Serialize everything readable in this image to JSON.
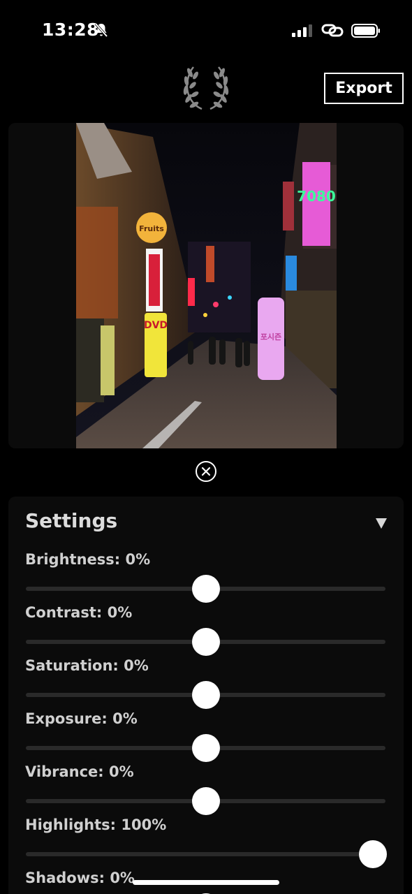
{
  "status_bar": {
    "time": "13:28"
  },
  "header": {
    "export_label": "Export"
  },
  "settings": {
    "title": "Settings",
    "sliders": [
      {
        "name": "Brightness",
        "label": "Brightness: 0%",
        "value": 0,
        "level": 0.5
      },
      {
        "name": "Contrast",
        "label": "Contrast: 0%",
        "value": 0,
        "level": 0.5
      },
      {
        "name": "Saturation",
        "label": "Saturation: 0%",
        "value": 0,
        "level": 0.5
      },
      {
        "name": "Exposure",
        "label": "Exposure: 0%",
        "value": 0,
        "level": 0.5
      },
      {
        "name": "Vibrance",
        "label": "Vibrance: 0%",
        "value": 0,
        "level": 0.5
      },
      {
        "name": "Highlights",
        "label": "Highlights: 100%",
        "value": 100,
        "level": 0.966
      },
      {
        "name": "Shadows",
        "label": "Shadows: 0%",
        "value": 0,
        "level": 0.5
      }
    ]
  },
  "photo": {
    "signs": [
      "7080",
      "Fruits",
      "DVD",
      "포시즌"
    ]
  },
  "colors": {
    "background": "#000000",
    "panel": "#0b0b0b",
    "track": "#2a2a2a",
    "thumb": "#ffffff"
  }
}
